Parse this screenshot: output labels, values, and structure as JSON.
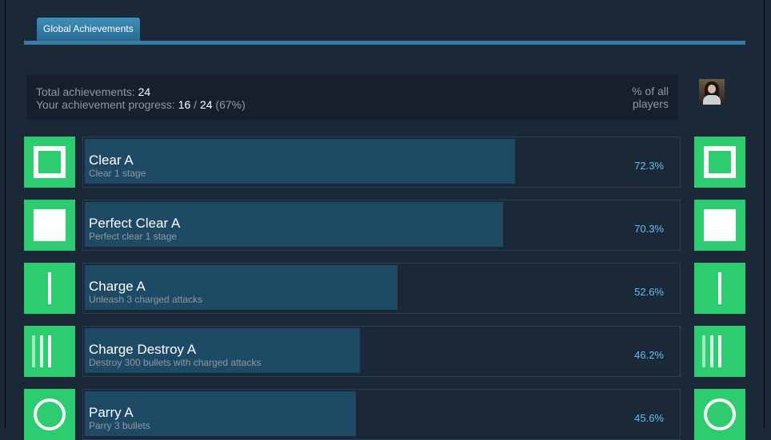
{
  "tabs": {
    "global_label": "Global Achievements"
  },
  "summary": {
    "total_label": "Total achievements:",
    "total_value": "24",
    "progress_label": "Your achievement progress:",
    "progress_done": "16",
    "progress_sep": "/",
    "progress_total": "24",
    "progress_pct": "(67%)",
    "pct_header": "% of all players"
  },
  "colors": {
    "accent": "#66c0f4",
    "icon_green": "#2ecc71",
    "bar_fill": "#1e4a66",
    "background": "#1b2838"
  },
  "achievements": [
    {
      "title": "Clear A",
      "desc": "Clear 1 stage",
      "pct": "72.3%",
      "fill_fraction": 0.723,
      "icon": "square-outline-icon"
    },
    {
      "title": "Perfect Clear A",
      "desc": "Perfect clear 1 stage",
      "pct": "70.3%",
      "fill_fraction": 0.703,
      "icon": "filled-square-icon"
    },
    {
      "title": "Charge A",
      "desc": "Unleash 3 charged attacks",
      "pct": "52.6%",
      "fill_fraction": 0.526,
      "icon": "single-bar-icon"
    },
    {
      "title": "Charge Destroy A",
      "desc": "Destroy 300 bullets with charged attacks",
      "pct": "46.2%",
      "fill_fraction": 0.462,
      "icon": "triple-bar-icon"
    },
    {
      "title": "Parry A",
      "desc": "Parry 3 bullets",
      "pct": "45.6%",
      "fill_fraction": 0.456,
      "icon": "circle-outline-icon"
    }
  ]
}
